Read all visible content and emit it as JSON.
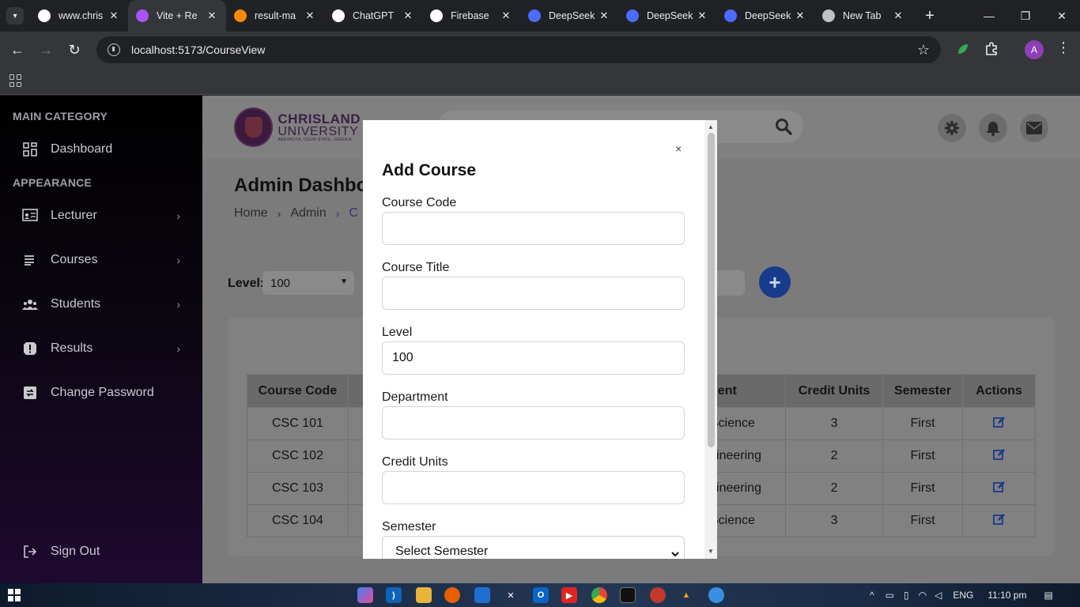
{
  "browser": {
    "tabs": [
      {
        "title": "www.chris",
        "active": false,
        "favicon": "google-icon",
        "color": "#ffffff"
      },
      {
        "title": "Vite + Re",
        "active": true,
        "favicon": "vite-icon",
        "color": "#a855f7"
      },
      {
        "title": "result-ma",
        "active": false,
        "favicon": "firebase-icon",
        "color": "#ff8a00"
      },
      {
        "title": "ChatGPT",
        "active": false,
        "favicon": "chatgpt-icon",
        "color": "#ffffff"
      },
      {
        "title": "Firebase",
        "active": false,
        "favicon": "github-copilot-icon",
        "color": "#ffffff"
      },
      {
        "title": "DeepSeek",
        "active": false,
        "favicon": "deepseek-icon",
        "color": "#4d6bfe"
      },
      {
        "title": "DeepSeek",
        "active": false,
        "favicon": "deepseek-icon",
        "color": "#4d6bfe"
      },
      {
        "title": "DeepSeek",
        "active": false,
        "favicon": "deepseek-icon",
        "color": "#4d6bfe"
      },
      {
        "title": "New Tab",
        "active": false,
        "favicon": "chrome-icon",
        "color": "#bdc1c6"
      }
    ],
    "url": "localhost:5173/CourseView",
    "profile_initial": "A"
  },
  "sidebar": {
    "categories": [
      "MAIN CATEGORY",
      "APPEARANCE"
    ],
    "items": [
      {
        "label": "Dashboard",
        "icon": "dashboard-icon"
      },
      {
        "label": "Lecturer",
        "icon": "lecturer-icon"
      },
      {
        "label": "Courses",
        "icon": "courses-icon"
      },
      {
        "label": "Students",
        "icon": "students-icon"
      },
      {
        "label": "Results",
        "icon": "results-icon"
      },
      {
        "label": "Change Password",
        "icon": "change-password-icon"
      }
    ],
    "signout": "Sign Out"
  },
  "header": {
    "logo": {
      "line1": "CHRISLAND",
      "line2": "UNIVERSITY",
      "line3": "ABEOKUTA, OGUN STATE, NIGERIA"
    }
  },
  "page": {
    "title": "Admin Dashbo",
    "breadcrumb": [
      "Home",
      "Admin",
      "C"
    ]
  },
  "filters": {
    "level_label": "Level:",
    "level_value": "100"
  },
  "table": {
    "headers": [
      "Course Code",
      "",
      "tment",
      "Credit Units",
      "Semester",
      "Actions"
    ],
    "rows": [
      [
        "CSC 101",
        "",
        "r Science",
        "3",
        "First"
      ],
      [
        "CSC 102",
        "",
        "ngineering",
        "2",
        "First"
      ],
      [
        "CSC 103",
        "",
        "ngineering",
        "2",
        "First"
      ],
      [
        "CSC 104",
        "",
        "r Science",
        "3",
        "First"
      ]
    ]
  },
  "modal": {
    "close": "×",
    "title": "Add Course",
    "fields": {
      "course_code": {
        "label": "Course Code",
        "value": ""
      },
      "course_title": {
        "label": "Course Title",
        "value": ""
      },
      "level": {
        "label": "Level",
        "value": "100"
      },
      "department": {
        "label": "Department",
        "value": ""
      },
      "credit_units": {
        "label": "Credit Units",
        "value": ""
      },
      "semester": {
        "label": "Semester",
        "value": "Select Semester"
      }
    }
  },
  "taskbar": {
    "language": "ENG",
    "time": "11:10 pm"
  },
  "colors": {
    "accent": "#173c8c",
    "sidebar": "#0b0610",
    "overlay": "#7b7b7b"
  }
}
